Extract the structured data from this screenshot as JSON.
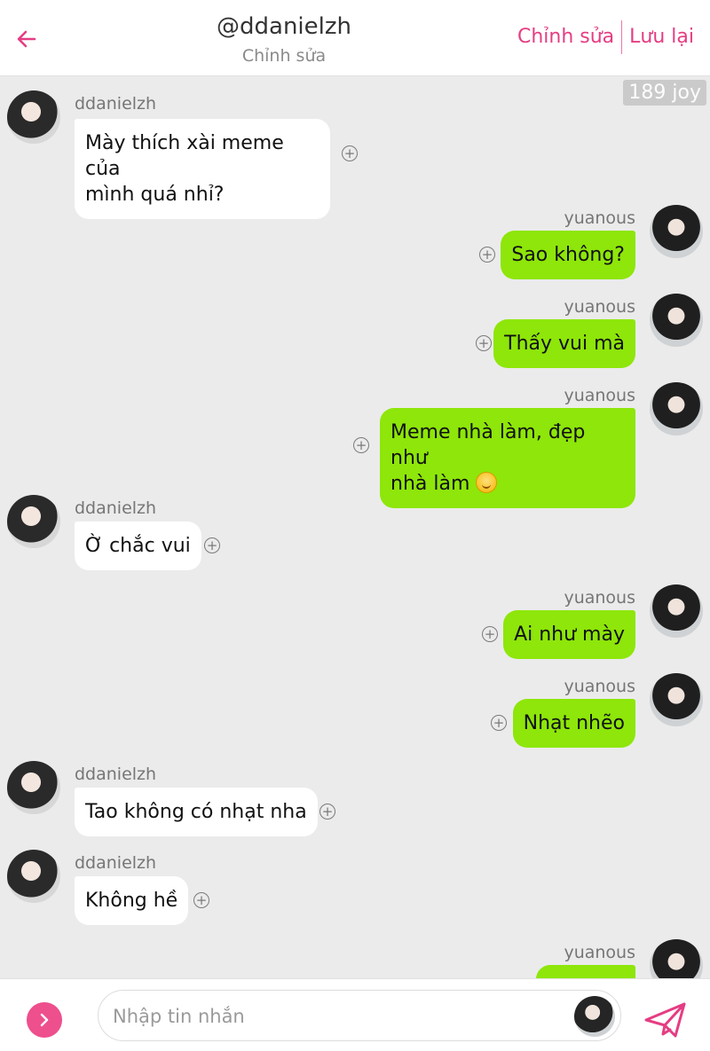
{
  "header": {
    "title": "@ddanielzh",
    "subtitle": "Chỉnh sửa",
    "edit_label": "Chỉnh sửa",
    "save_label": "Lưu lại",
    "accent": "#e53d83"
  },
  "joy": "189 joy",
  "messages": [
    {
      "side": "left",
      "sender": "ddanielzh",
      "text_lines": [
        "Mày thích xài meme của",
        "mình quá nhỉ?"
      ]
    },
    {
      "side": "right",
      "sender": "yuanous",
      "text_lines": [
        "Sao không?"
      ]
    },
    {
      "side": "right",
      "sender": "yuanous",
      "text_lines": [
        "Thấy vui mà"
      ]
    },
    {
      "side": "right",
      "sender": "yuanous",
      "text_lines": [
        "Meme nhà làm, đẹp như",
        "nhà làm"
      ],
      "emoji": "smiling-face"
    },
    {
      "side": "left",
      "sender": "ddanielzh",
      "text_lines": [
        "Ờ chắc vui"
      ]
    },
    {
      "side": "right",
      "sender": "yuanous",
      "text_lines": [
        "Ai như mày"
      ]
    },
    {
      "side": "right",
      "sender": "yuanous",
      "text_lines": [
        "Nhạt nhẽo"
      ]
    },
    {
      "side": "left",
      "sender": "ddanielzh",
      "text_lines": [
        "Tao không có nhạt nha"
      ]
    },
    {
      "side": "left",
      "sender": "ddanielzh",
      "text_lines": [
        "Không hề"
      ]
    },
    {
      "side": "right",
      "sender": "yuanous",
      "text_lines": []
    }
  ],
  "input": {
    "placeholder": "Nhập tin nhắn",
    "value": ""
  },
  "colors": {
    "bubble_right": "#8ee60a",
    "bubble_left": "#ffffff",
    "background": "#ebebeb",
    "pink_button": "#ee4f8d"
  },
  "icons": {
    "back": "arrow-left-icon",
    "add": "plus-circle-icon",
    "expand": "chevron-right-icon",
    "send": "paper-plane-icon"
  }
}
